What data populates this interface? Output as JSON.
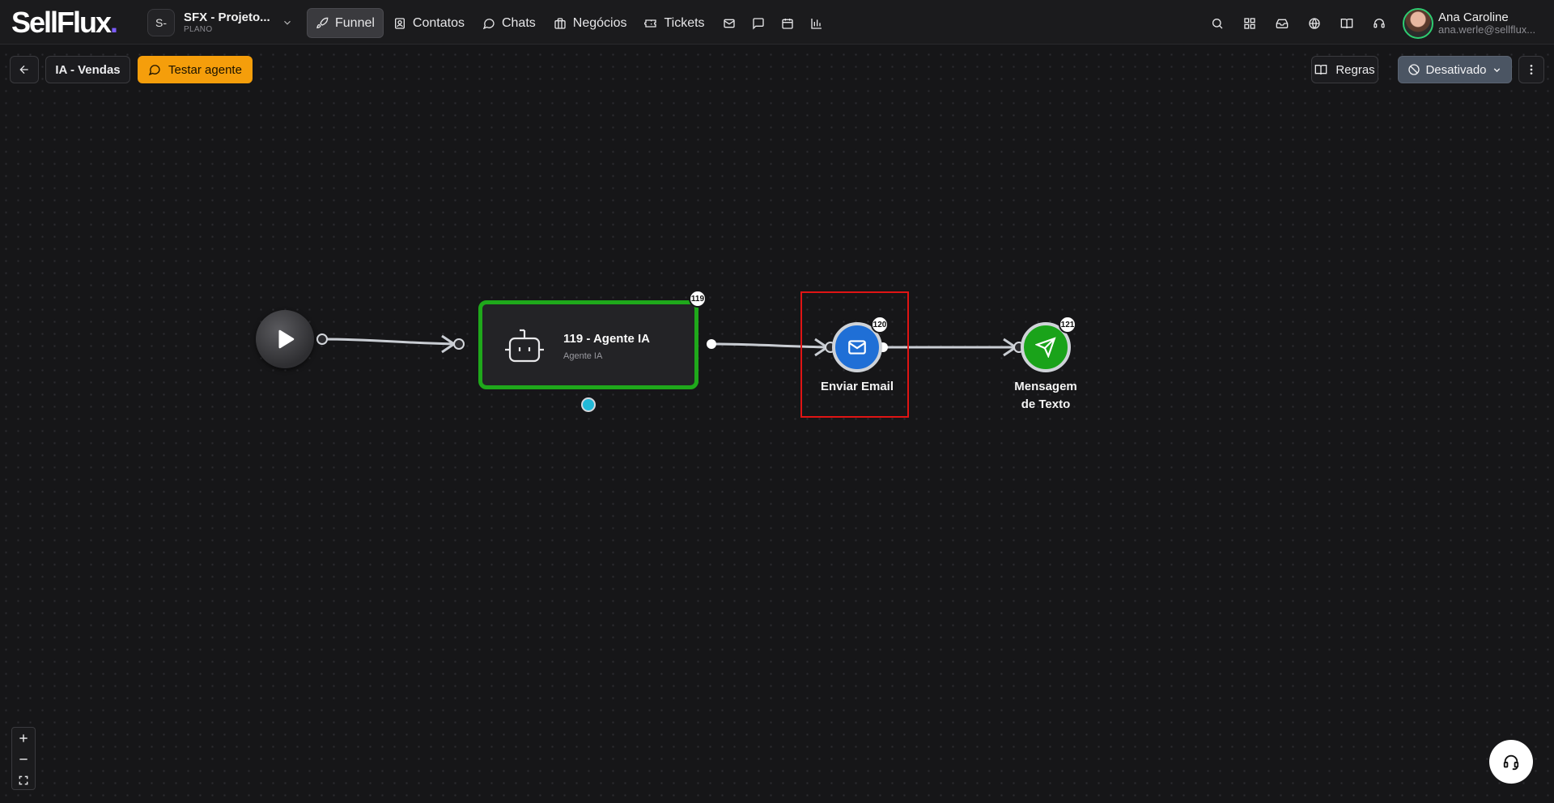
{
  "app": {
    "logo_text": "SellFlux",
    "logo_dot": ".",
    "project": {
      "badge": "S-",
      "name": "SFX - Projeto...",
      "plan": "PLANO"
    }
  },
  "nav": {
    "items": [
      {
        "label": "Funnel",
        "icon": "rocket-icon",
        "active": true
      },
      {
        "label": "Contatos",
        "icon": "contacts-icon",
        "active": false
      },
      {
        "label": "Chats",
        "icon": "chat-icon",
        "active": false
      },
      {
        "label": "Negócios",
        "icon": "briefcase-icon",
        "active": false
      },
      {
        "label": "Tickets",
        "icon": "ticket-icon",
        "active": false
      }
    ],
    "extra_icons": [
      "mail-icon",
      "message-square-icon",
      "calendar-icon",
      "bar-chart-icon"
    ],
    "right_icons": [
      "search-icon",
      "grid-icon",
      "inbox-icon",
      "globe-icon",
      "book-icon",
      "headset-icon"
    ]
  },
  "user": {
    "name": "Ana Caroline",
    "email": "ana.werle@sellflux..."
  },
  "toolbar": {
    "flow_name": "IA - Vendas",
    "test_label": "Testar agente",
    "rules_label": "Regras",
    "status_label": "Desativado"
  },
  "flow": {
    "agent": {
      "badge": "119",
      "title": "119 - Agente IA",
      "subtitle": "Agente IA",
      "border_color": "#1fa81b"
    },
    "email": {
      "badge": "120",
      "label": "Enviar Email",
      "color": "#1f6fd6"
    },
    "message": {
      "badge": "121",
      "label_line1": "Mensagem",
      "label_line2": "de Texto",
      "color": "#1aa31a"
    }
  },
  "colors": {
    "accent": "#f59e0b",
    "highlight": "#e01414",
    "status_bg": "#4b5563"
  }
}
